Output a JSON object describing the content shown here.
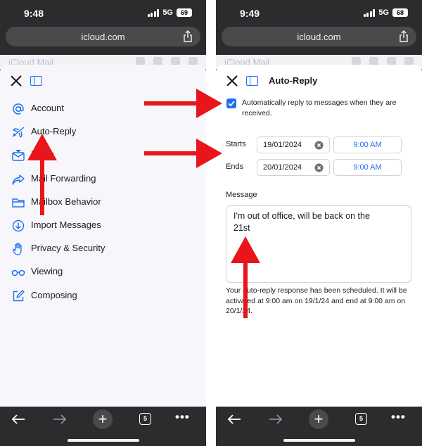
{
  "left_phone": {
    "status": {
      "time": "9:48",
      "network": "5G",
      "battery": "69"
    },
    "address": {
      "url": "icloud.com"
    },
    "peek_title": "iCloud Mail",
    "menu": [
      {
        "label": "Account",
        "icon": "at-icon"
      },
      {
        "label": "Auto-Reply",
        "icon": "airplane-icon"
      },
      {
        "label": "Rules",
        "icon": "mail-filter-icon"
      },
      {
        "label": "Mail Forwarding",
        "icon": "forward-icon"
      },
      {
        "label": "Mailbox Behavior",
        "icon": "folder-icon"
      },
      {
        "label": "Import Messages",
        "icon": "import-icon"
      },
      {
        "label": "Privacy & Security",
        "icon": "hand-icon"
      },
      {
        "label": "Viewing",
        "icon": "glasses-icon"
      },
      {
        "label": "Composing",
        "icon": "compose-icon"
      }
    ],
    "toolbar": {
      "tab_count": "5",
      "more": "•••"
    }
  },
  "right_phone": {
    "status": {
      "time": "9:49",
      "network": "5G",
      "battery": "68"
    },
    "address": {
      "url": "icloud.com"
    },
    "peek_title": "iCloud Mail",
    "sheet_title": "Auto-Reply",
    "auto_reply": {
      "checked": true,
      "label": "Automatically reply to messages when they are received."
    },
    "starts": {
      "label": "Starts",
      "date": "19/01/2024",
      "time": "9:00 AM"
    },
    "ends": {
      "label": "Ends",
      "date": "20/01/2024",
      "time": "9:00 AM"
    },
    "message": {
      "label": "Message",
      "text": "I'm out of office, will be back on the\n21st"
    },
    "schedule_note": "Your auto-reply response has been scheduled. It will be activated at 9:00 am on 19/1/24 and end at 9:00 am on 20/1/24.",
    "toolbar": {
      "tab_count": "5",
      "more": "•••"
    }
  },
  "colors": {
    "accent": "#1f6ff2",
    "annotation": "#e8161b",
    "chrome": "#2c2c2e"
  }
}
